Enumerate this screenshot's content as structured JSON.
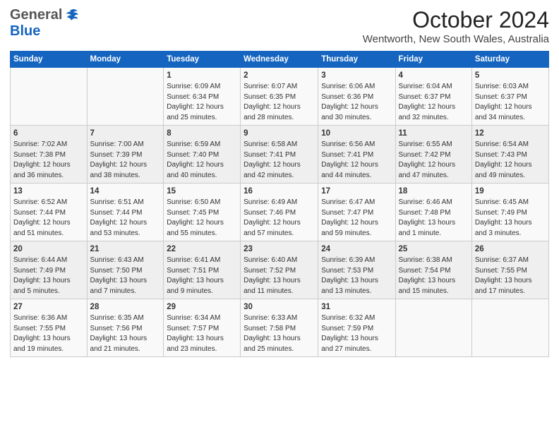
{
  "header": {
    "logo_general": "General",
    "logo_blue": "Blue",
    "title": "October 2024",
    "subtitle": "Wentworth, New South Wales, Australia"
  },
  "days_of_week": [
    "Sunday",
    "Monday",
    "Tuesday",
    "Wednesday",
    "Thursday",
    "Friday",
    "Saturday"
  ],
  "weeks": [
    [
      {
        "day": "",
        "info": ""
      },
      {
        "day": "",
        "info": ""
      },
      {
        "day": "1",
        "info": "Sunrise: 6:09 AM\nSunset: 6:34 PM\nDaylight: 12 hours\nand 25 minutes."
      },
      {
        "day": "2",
        "info": "Sunrise: 6:07 AM\nSunset: 6:35 PM\nDaylight: 12 hours\nand 28 minutes."
      },
      {
        "day": "3",
        "info": "Sunrise: 6:06 AM\nSunset: 6:36 PM\nDaylight: 12 hours\nand 30 minutes."
      },
      {
        "day": "4",
        "info": "Sunrise: 6:04 AM\nSunset: 6:37 PM\nDaylight: 12 hours\nand 32 minutes."
      },
      {
        "day": "5",
        "info": "Sunrise: 6:03 AM\nSunset: 6:37 PM\nDaylight: 12 hours\nand 34 minutes."
      }
    ],
    [
      {
        "day": "6",
        "info": "Sunrise: 7:02 AM\nSunset: 7:38 PM\nDaylight: 12 hours\nand 36 minutes."
      },
      {
        "day": "7",
        "info": "Sunrise: 7:00 AM\nSunset: 7:39 PM\nDaylight: 12 hours\nand 38 minutes."
      },
      {
        "day": "8",
        "info": "Sunrise: 6:59 AM\nSunset: 7:40 PM\nDaylight: 12 hours\nand 40 minutes."
      },
      {
        "day": "9",
        "info": "Sunrise: 6:58 AM\nSunset: 7:41 PM\nDaylight: 12 hours\nand 42 minutes."
      },
      {
        "day": "10",
        "info": "Sunrise: 6:56 AM\nSunset: 7:41 PM\nDaylight: 12 hours\nand 44 minutes."
      },
      {
        "day": "11",
        "info": "Sunrise: 6:55 AM\nSunset: 7:42 PM\nDaylight: 12 hours\nand 47 minutes."
      },
      {
        "day": "12",
        "info": "Sunrise: 6:54 AM\nSunset: 7:43 PM\nDaylight: 12 hours\nand 49 minutes."
      }
    ],
    [
      {
        "day": "13",
        "info": "Sunrise: 6:52 AM\nSunset: 7:44 PM\nDaylight: 12 hours\nand 51 minutes."
      },
      {
        "day": "14",
        "info": "Sunrise: 6:51 AM\nSunset: 7:44 PM\nDaylight: 12 hours\nand 53 minutes."
      },
      {
        "day": "15",
        "info": "Sunrise: 6:50 AM\nSunset: 7:45 PM\nDaylight: 12 hours\nand 55 minutes."
      },
      {
        "day": "16",
        "info": "Sunrise: 6:49 AM\nSunset: 7:46 PM\nDaylight: 12 hours\nand 57 minutes."
      },
      {
        "day": "17",
        "info": "Sunrise: 6:47 AM\nSunset: 7:47 PM\nDaylight: 12 hours\nand 59 minutes."
      },
      {
        "day": "18",
        "info": "Sunrise: 6:46 AM\nSunset: 7:48 PM\nDaylight: 13 hours\nand 1 minute."
      },
      {
        "day": "19",
        "info": "Sunrise: 6:45 AM\nSunset: 7:49 PM\nDaylight: 13 hours\nand 3 minutes."
      }
    ],
    [
      {
        "day": "20",
        "info": "Sunrise: 6:44 AM\nSunset: 7:49 PM\nDaylight: 13 hours\nand 5 minutes."
      },
      {
        "day": "21",
        "info": "Sunrise: 6:43 AM\nSunset: 7:50 PM\nDaylight: 13 hours\nand 7 minutes."
      },
      {
        "day": "22",
        "info": "Sunrise: 6:41 AM\nSunset: 7:51 PM\nDaylight: 13 hours\nand 9 minutes."
      },
      {
        "day": "23",
        "info": "Sunrise: 6:40 AM\nSunset: 7:52 PM\nDaylight: 13 hours\nand 11 minutes."
      },
      {
        "day": "24",
        "info": "Sunrise: 6:39 AM\nSunset: 7:53 PM\nDaylight: 13 hours\nand 13 minutes."
      },
      {
        "day": "25",
        "info": "Sunrise: 6:38 AM\nSunset: 7:54 PM\nDaylight: 13 hours\nand 15 minutes."
      },
      {
        "day": "26",
        "info": "Sunrise: 6:37 AM\nSunset: 7:55 PM\nDaylight: 13 hours\nand 17 minutes."
      }
    ],
    [
      {
        "day": "27",
        "info": "Sunrise: 6:36 AM\nSunset: 7:55 PM\nDaylight: 13 hours\nand 19 minutes."
      },
      {
        "day": "28",
        "info": "Sunrise: 6:35 AM\nSunset: 7:56 PM\nDaylight: 13 hours\nand 21 minutes."
      },
      {
        "day": "29",
        "info": "Sunrise: 6:34 AM\nSunset: 7:57 PM\nDaylight: 13 hours\nand 23 minutes."
      },
      {
        "day": "30",
        "info": "Sunrise: 6:33 AM\nSunset: 7:58 PM\nDaylight: 13 hours\nand 25 minutes."
      },
      {
        "day": "31",
        "info": "Sunrise: 6:32 AM\nSunset: 7:59 PM\nDaylight: 13 hours\nand 27 minutes."
      },
      {
        "day": "",
        "info": ""
      },
      {
        "day": "",
        "info": ""
      }
    ]
  ]
}
